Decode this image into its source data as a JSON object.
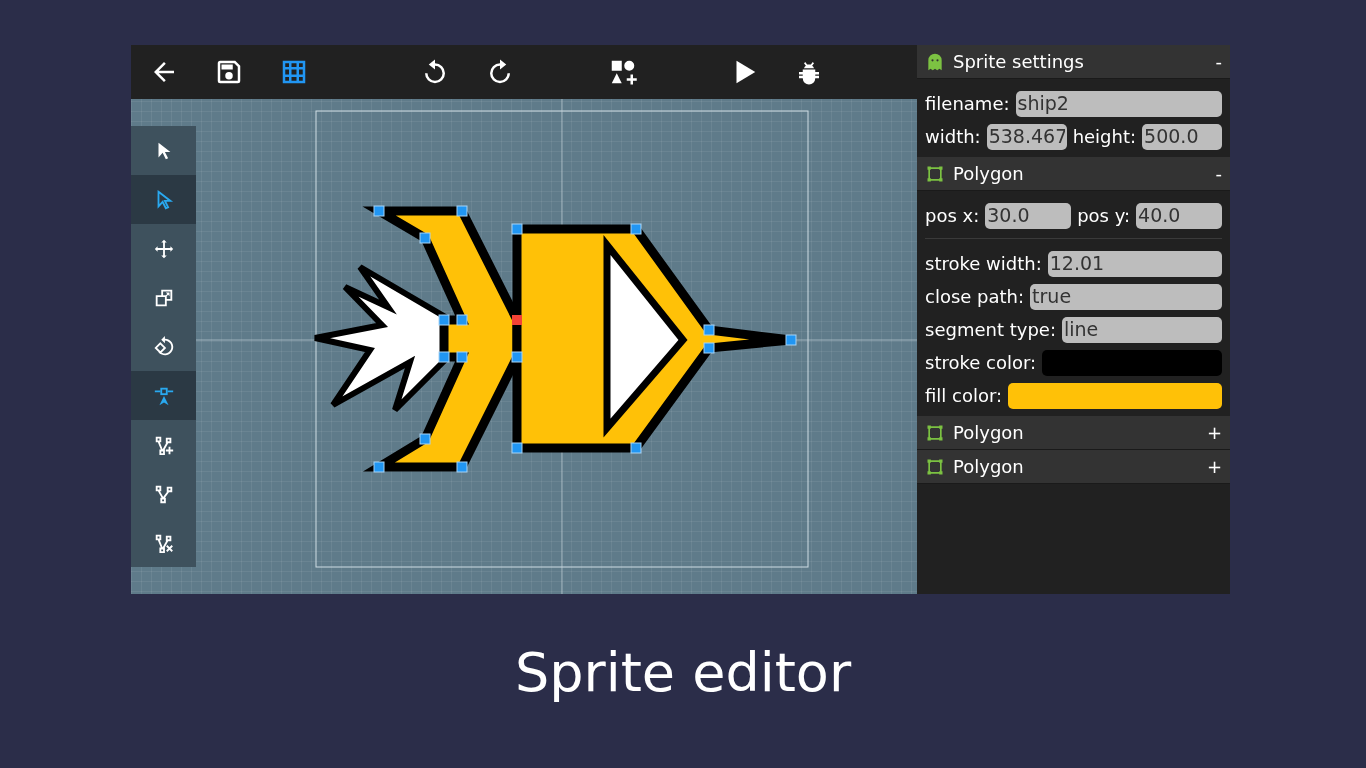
{
  "toolbar": [
    {
      "kind": "back",
      "selected": false
    },
    {
      "kind": "save",
      "selected": false
    },
    {
      "kind": "grid",
      "selected": true
    },
    {
      "kind": "undo",
      "selected": false
    },
    {
      "kind": "redo",
      "selected": false
    },
    {
      "kind": "shapes",
      "selected": false
    },
    {
      "kind": "play",
      "selected": false
    },
    {
      "kind": "debug",
      "selected": false
    }
  ],
  "tools": [
    {
      "kind": "select",
      "selected": false
    },
    {
      "kind": "direct-select",
      "selected": true
    },
    {
      "kind": "move",
      "selected": false
    },
    {
      "kind": "scale",
      "selected": false
    },
    {
      "kind": "rotate",
      "selected": false
    },
    {
      "kind": "point",
      "selected": true
    },
    {
      "kind": "add-point",
      "selected": false
    },
    {
      "kind": "path",
      "selected": false
    },
    {
      "kind": "delete-point",
      "selected": false
    }
  ],
  "panels": [
    {
      "kind": "sprite",
      "title": "Sprite settings",
      "toggle": "-",
      "rows": [
        {
          "fields": [
            {
              "label": "filename:",
              "value": "ship2"
            }
          ]
        },
        {
          "fields": [
            {
              "label": "width:",
              "value": "538.467"
            },
            {
              "label": "height:",
              "value": "500.0"
            }
          ]
        }
      ]
    },
    {
      "kind": "polygon",
      "title": "Polygon",
      "toggle": "-",
      "rows": [
        {
          "fields": [
            {
              "label": "pos x:",
              "value": "30.0"
            },
            {
              "label": "pos y:",
              "value": "40.0"
            }
          ]
        },
        {
          "kind": "divider"
        },
        {
          "fields": [
            {
              "label": "stroke width:",
              "value": "12.01"
            }
          ]
        },
        {
          "fields": [
            {
              "label": "close path:",
              "value": "true"
            }
          ]
        },
        {
          "fields": [
            {
              "label": "segment type:",
              "value": "line"
            }
          ]
        },
        {
          "fields": [
            {
              "kind": "color",
              "label": "stroke color:",
              "color": "#000000"
            }
          ]
        },
        {
          "fields": [
            {
              "kind": "color",
              "label": "fill color:",
              "color": "#ffc107"
            }
          ]
        }
      ]
    },
    {
      "kind": "polygon",
      "title": "Polygon",
      "toggle": "+"
    },
    {
      "kind": "polygon",
      "title": "Polygon",
      "toggle": "+"
    }
  ],
  "caption": "Sprite editor"
}
